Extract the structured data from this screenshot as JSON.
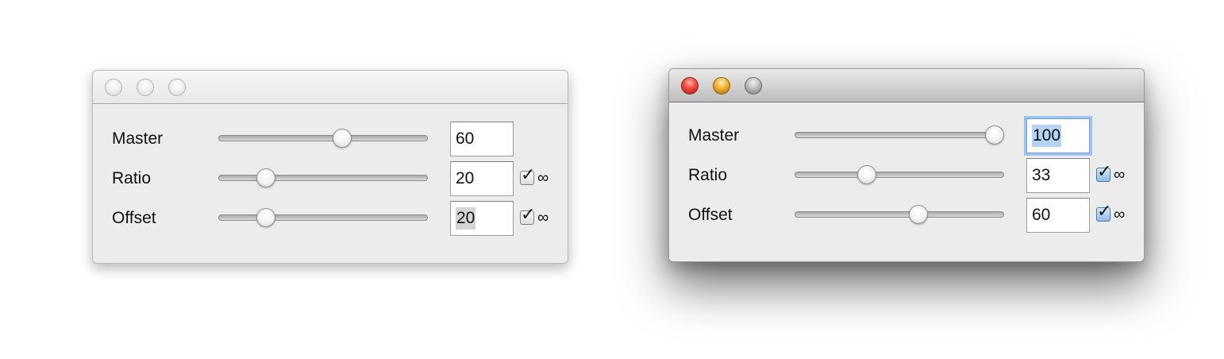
{
  "windows": [
    {
      "state": "inactive",
      "rows": [
        {
          "label": "Master",
          "value": "60",
          "slider_fraction": 0.6,
          "has_checkbox": false
        },
        {
          "label": "Ratio",
          "value": "20",
          "slider_fraction": 0.2,
          "has_checkbox": true,
          "checked": true,
          "checkbox_label": "∞"
        },
        {
          "label": "Offset",
          "value": "20",
          "slider_fraction": 0.2,
          "has_checkbox": true,
          "checked": true,
          "checkbox_label": "∞"
        }
      ]
    },
    {
      "state": "active",
      "rows": [
        {
          "label": "Master",
          "value": "100",
          "slider_fraction": 1.0,
          "has_checkbox": false
        },
        {
          "label": "Ratio",
          "value": "33",
          "slider_fraction": 0.33,
          "has_checkbox": true,
          "checked": true,
          "checkbox_label": "∞"
        },
        {
          "label": "Offset",
          "value": "60",
          "slider_fraction": 0.6,
          "has_checkbox": true,
          "checked": true,
          "checkbox_label": "∞"
        }
      ]
    }
  ],
  "colors": {
    "close_active": "#f0463c",
    "minimize_active": "#f0b02d",
    "zoom_active": "#b6b6b6",
    "focus_ring": "#9ec3f0",
    "selection_active": "#b4d3f5",
    "selection_inactive": "#d4d4d4"
  },
  "icons": {
    "checkbox": "checkmark-icon"
  }
}
